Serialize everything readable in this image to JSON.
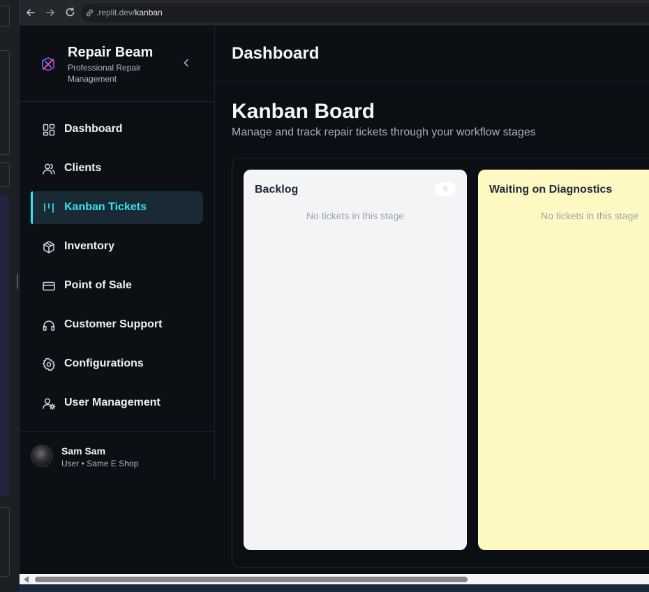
{
  "browser": {
    "url_domain": ".replit.dev/",
    "url_path": "kanban"
  },
  "brand": {
    "name": "Repair Beam",
    "subtitle": "Professional Repair Management"
  },
  "nav": {
    "items": [
      {
        "label": "Dashboard",
        "icon": "layout-grid-icon",
        "active": false
      },
      {
        "label": "Clients",
        "icon": "users-icon",
        "active": false
      },
      {
        "label": "Kanban Tickets",
        "icon": "kanban-icon",
        "active": true
      },
      {
        "label": "Inventory",
        "icon": "package-icon",
        "active": false
      },
      {
        "label": "Point of Sale",
        "icon": "credit-card-icon",
        "active": false
      },
      {
        "label": "Customer Support",
        "icon": "headphones-icon",
        "active": false
      },
      {
        "label": "Configurations",
        "icon": "gear-icon",
        "active": false
      },
      {
        "label": "User Management",
        "icon": "user-cog-icon",
        "active": false
      }
    ]
  },
  "user": {
    "name": "Sam Sam",
    "meta": "User • Same E Shop"
  },
  "header": {
    "title": "Dashboard"
  },
  "board": {
    "title": "Kanban Board",
    "subtitle": "Manage and track repair tickets through your workflow stages",
    "columns": [
      {
        "title": "Backlog",
        "count": "0",
        "empty_text": "No tickets in this stage",
        "color": "#f3f4f6"
      },
      {
        "title": "Waiting on Diagnostics",
        "empty_text": "No tickets in this stage",
        "color": "#fef9c3"
      }
    ]
  },
  "colors": {
    "accent": "#35e3ee",
    "sidebar_bg": "#0c1015",
    "active_item_bg": "#1a2a35"
  }
}
